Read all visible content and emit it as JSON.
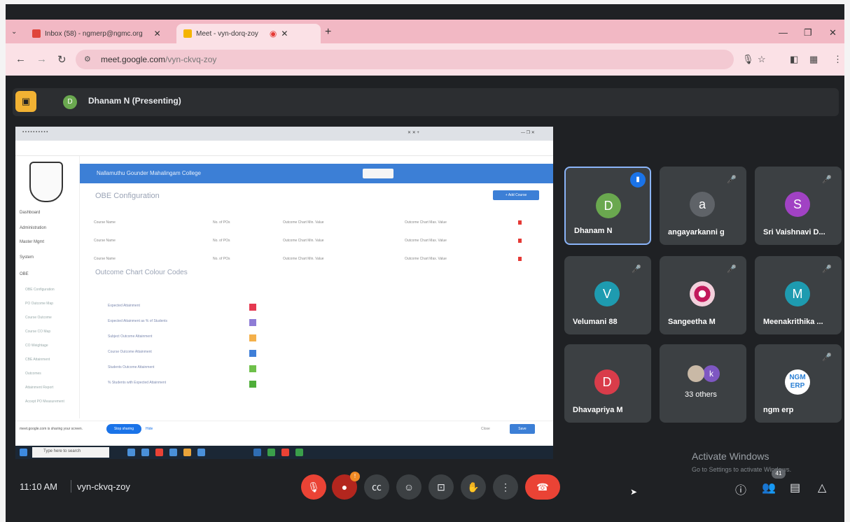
{
  "browser": {
    "tabs": [
      {
        "title": "Inbox (58) - ngmerp@ngmc.org"
      },
      {
        "title": "Meet - vyn-dorq-zoy"
      }
    ],
    "url_host": "meet.google.com",
    "url_path": "/vyn-ckvq-zoy"
  },
  "presenter": {
    "initial": "D",
    "label": "Dhanam N (Presenting)"
  },
  "shared_screen": {
    "app_title": "Nallamuthu Gounder Mahalingam College",
    "page_heading": "OBE Configuration",
    "add_button": "+ Add Course",
    "sidebar_items": [
      "Dashboard",
      "Administration",
      "Master Mgmt",
      "System",
      "OBE"
    ],
    "sidebar_subitems": [
      "OBE Configuration",
      "PO Outcome Map",
      "Course Outcome",
      "Course CO Map",
      "CO Weightage",
      "CBE Attainment",
      "Outcomes",
      "Attainment Report",
      "Accept PO Measurement"
    ],
    "rows": [
      {
        "course_name": "Course Name",
        "no_pos": "No. of POs",
        "max_value": "Outcome Chart Min. Value",
        "max2": "Outcome Chart Max. Value"
      },
      {
        "course_name": "Course Name",
        "no_pos": "No. of POs",
        "max_value": "Outcome Chart Min. Value",
        "max2": "Outcome Chart Max. Value"
      },
      {
        "course_name": "Course Name",
        "no_pos": "No. of POs",
        "max_value": "Outcome Chart Min. Value",
        "max2": "Outcome Chart Max. Value"
      }
    ],
    "colour_heading": "Outcome Chart Colour Codes",
    "colour_rows": [
      {
        "label": "Expected Attainment",
        "color": "#e53950"
      },
      {
        "label": "Expected Attainment as % of Students",
        "color": "#8e7cd6"
      },
      {
        "label": "Subject Outcome Attainment",
        "color": "#f4b04a"
      },
      {
        "label": "Course Outcome Attainment",
        "color": "#3f7fd8"
      },
      {
        "label": "Students Outcome Attainment",
        "color": "#6ec04a"
      },
      {
        "label": "% Students with Expected Attainment",
        "color": "#4fae3a"
      }
    ],
    "share_notice": "meet.google.com is sharing your screen.",
    "stop_sharing": "Stop sharing",
    "hide": "Hide",
    "close": "Close",
    "save": "Save",
    "taskbar_search": "Type here to search"
  },
  "participants": [
    {
      "name": "Dhanam N",
      "initial": "D",
      "color": "#6aa84f",
      "active": true,
      "speaking": true,
      "muted": false
    },
    {
      "name": "angayarkanni g",
      "initial": "a",
      "color": "#5f6368",
      "active": false,
      "speaking": false,
      "muted": true
    },
    {
      "name": "Sri Vaishnavi D...",
      "initial": "S",
      "color": "#a142c4",
      "active": false,
      "speaking": false,
      "muted": true
    },
    {
      "name": "Velumani 88",
      "initial": "V",
      "color": "#1e9bb0",
      "active": false,
      "speaking": false,
      "muted": true
    },
    {
      "name": "Sangeetha M",
      "initial": "",
      "color": "#c2185b",
      "active": false,
      "speaking": false,
      "muted": true
    },
    {
      "name": "Meenakrithika ...",
      "initial": "M",
      "color": "#1e9bb0",
      "active": false,
      "speaking": false,
      "muted": true
    },
    {
      "name": "Dhavapriya M",
      "initial": "D",
      "color": "#d93c4a",
      "active": false,
      "speaking": false,
      "muted": false
    },
    {
      "name": "33 others",
      "initial": "k",
      "color": "#7e57c2",
      "active": false,
      "speaking": false,
      "muted": false
    },
    {
      "name": "ngm erp",
      "initial": "NGM ERP",
      "color": "#ffffff",
      "active": false,
      "speaking": false,
      "muted": true
    }
  ],
  "activate": {
    "title": "Activate Windows",
    "subtitle": "Go to Settings to activate Windows."
  },
  "meeting": {
    "time": "11:10 AM",
    "code": "vyn-ckvq-zoy",
    "people_count": "41"
  }
}
